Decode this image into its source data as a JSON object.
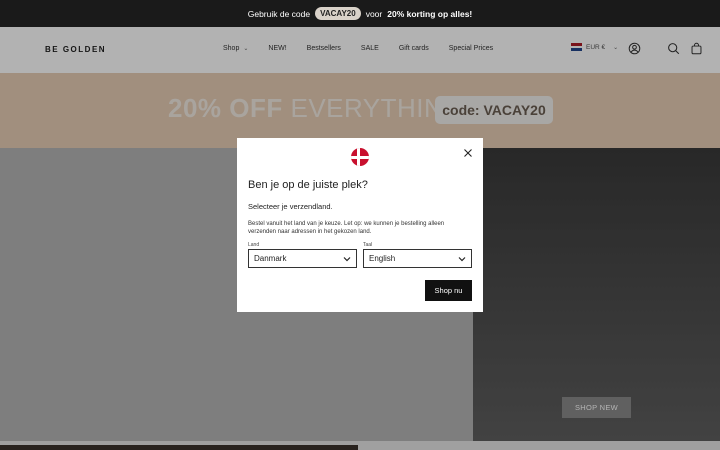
{
  "announcement": {
    "prefix": "Gebruik de code",
    "code": "VACAY20",
    "middle": "voor",
    "bold": "20% korting op alles!"
  },
  "header": {
    "logo": "BE GOLDEN",
    "nav": [
      "Shop",
      "NEW!",
      "Bestsellers",
      "SALE",
      "Gift cards",
      "Special Prices"
    ],
    "currency": "EUR €",
    "icons": [
      "account-icon",
      "search-icon",
      "cart-icon"
    ]
  },
  "promo": {
    "pct": "20% OFF",
    "rest": " EVERYTHING",
    "code": "code: VACAY20"
  },
  "hero": {
    "cta": "SHOP NEW"
  },
  "modal": {
    "title": "Ben je op de juiste plek?",
    "subtitle": "Selecteer je verzendland.",
    "description": "Bestel vanuit het land van je keuze. Let op: we kunnen je bestelling alleen verzenden naar adressen in het gekozen land.",
    "country_label": "Land",
    "country_value": "Danmark",
    "language_label": "Taal",
    "language_value": "English",
    "submit": "Shop nu"
  },
  "colors": {
    "announcement_bg": "#1a1a1a",
    "promo_bg": "#e7cdb5",
    "dk_red": "#c8102e"
  }
}
